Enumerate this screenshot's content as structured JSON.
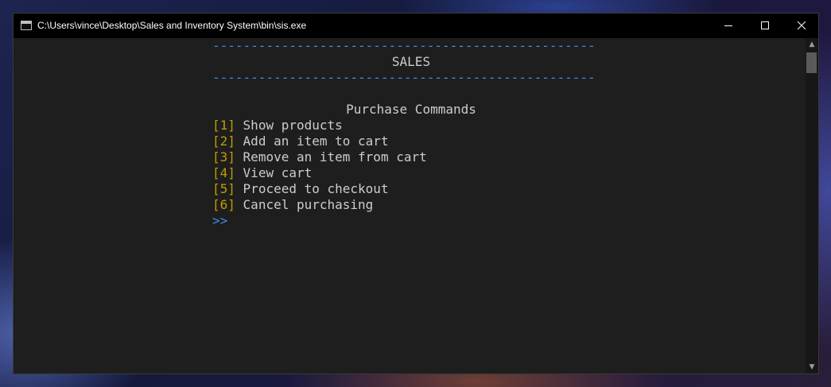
{
  "window": {
    "title": "C:\\Users\\vince\\Desktop\\Sales and Inventory System\\bin\\sis.exe",
    "icon": "console-app-icon"
  },
  "console": {
    "separator": "--------------------------------------------------",
    "heading": "SALES",
    "section_title": "Purchase Commands",
    "commands": [
      {
        "key": "[1]",
        "label": "Show products"
      },
      {
        "key": "[2]",
        "label": "Add an item to cart"
      },
      {
        "key": "[3]",
        "label": "Remove an item from cart"
      },
      {
        "key": "[4]",
        "label": "View cart"
      },
      {
        "key": "[5]",
        "label": "Proceed to checkout"
      },
      {
        "key": "[6]",
        "label": "Cancel purchasing"
      }
    ],
    "prompt": ">>"
  },
  "colors": {
    "separator": "#3b8eea",
    "key": "#c19c00",
    "text": "#cccccc",
    "background": "#1e1e1e"
  }
}
